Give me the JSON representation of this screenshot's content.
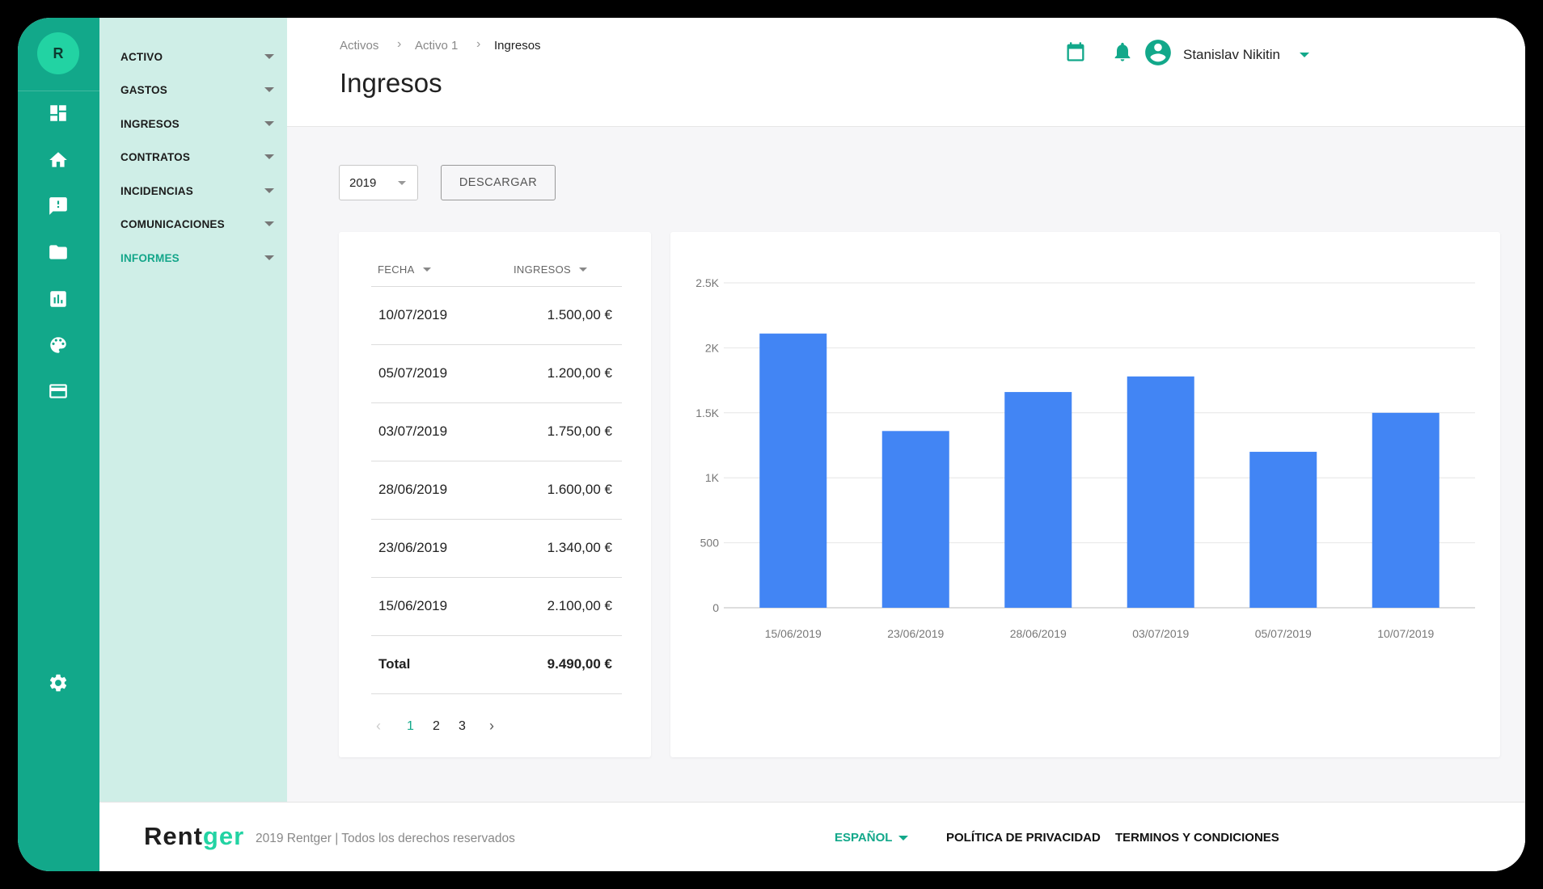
{
  "app": {
    "avatar_letter": "R",
    "brand_main": "Rent",
    "brand_accent": "ger"
  },
  "menu": {
    "items": [
      {
        "label": "ACTIVO",
        "active": false
      },
      {
        "label": "GASTOS",
        "active": false
      },
      {
        "label": "INGRESOS",
        "active": false
      },
      {
        "label": "CONTRATOS",
        "active": false
      },
      {
        "label": "INCIDENCIAS",
        "active": false
      },
      {
        "label": "COMUNICACIONES",
        "active": false
      },
      {
        "label": "INFORMES",
        "active": true
      }
    ]
  },
  "rail_icons": [
    "dashboard-icon",
    "home-icon",
    "feedback-icon",
    "folder-icon",
    "bar-chart-icon",
    "palette-icon",
    "credit-card-icon",
    "settings-icon"
  ],
  "header": {
    "breadcrumb": [
      "Activos",
      "Activo 1",
      "Ingresos"
    ],
    "title": "Ingresos",
    "user_name": "Stanislav Nikitin"
  },
  "toolbar": {
    "year": "2019",
    "download_label": "DESCARGAR"
  },
  "table": {
    "col_date": "FECHA",
    "col_amount": "INGRESOS",
    "rows": [
      {
        "date": "10/07/2019",
        "amount": "1.500,00 €"
      },
      {
        "date": "05/07/2019",
        "amount": "1.200,00 €"
      },
      {
        "date": "03/07/2019",
        "amount": "1.750,00 €"
      },
      {
        "date": "28/06/2019",
        "amount": "1.600,00 €"
      },
      {
        "date": "23/06/2019",
        "amount": "1.340,00 €"
      },
      {
        "date": "15/06/2019",
        "amount": "2.100,00 €"
      }
    ],
    "total_label": "Total",
    "total_amount": "9.490,00 €",
    "pages": [
      "1",
      "2",
      "3"
    ],
    "current_page": "1",
    "prev_symbol": "‹",
    "next_symbol": "›"
  },
  "chart_data": {
    "type": "bar",
    "categories": [
      "15/06/2019",
      "23/06/2019",
      "28/06/2019",
      "03/07/2019",
      "05/07/2019",
      "10/07/2019"
    ],
    "values": [
      2110,
      1360,
      1660,
      1780,
      1200,
      1500
    ],
    "ylim": [
      0,
      2500
    ],
    "yticks": [
      0,
      500,
      1000,
      1500,
      2000,
      2500
    ],
    "ytick_labels": [
      "0",
      "500",
      "1K",
      "1.5K",
      "2K",
      "2.5K"
    ],
    "grid": true,
    "bar_color": "#4285f4"
  },
  "footer": {
    "copyright": "2019 Rentger | Todos los derechos reservados",
    "language": "ESPAÑOL",
    "privacy": "POLÍTICA DE PRIVACIDAD",
    "terms": "TERMINOS Y CONDICIONES"
  },
  "colors": {
    "primary": "#12a88a",
    "accent": "#22d3a3",
    "menu_bg": "#cfeee7"
  }
}
